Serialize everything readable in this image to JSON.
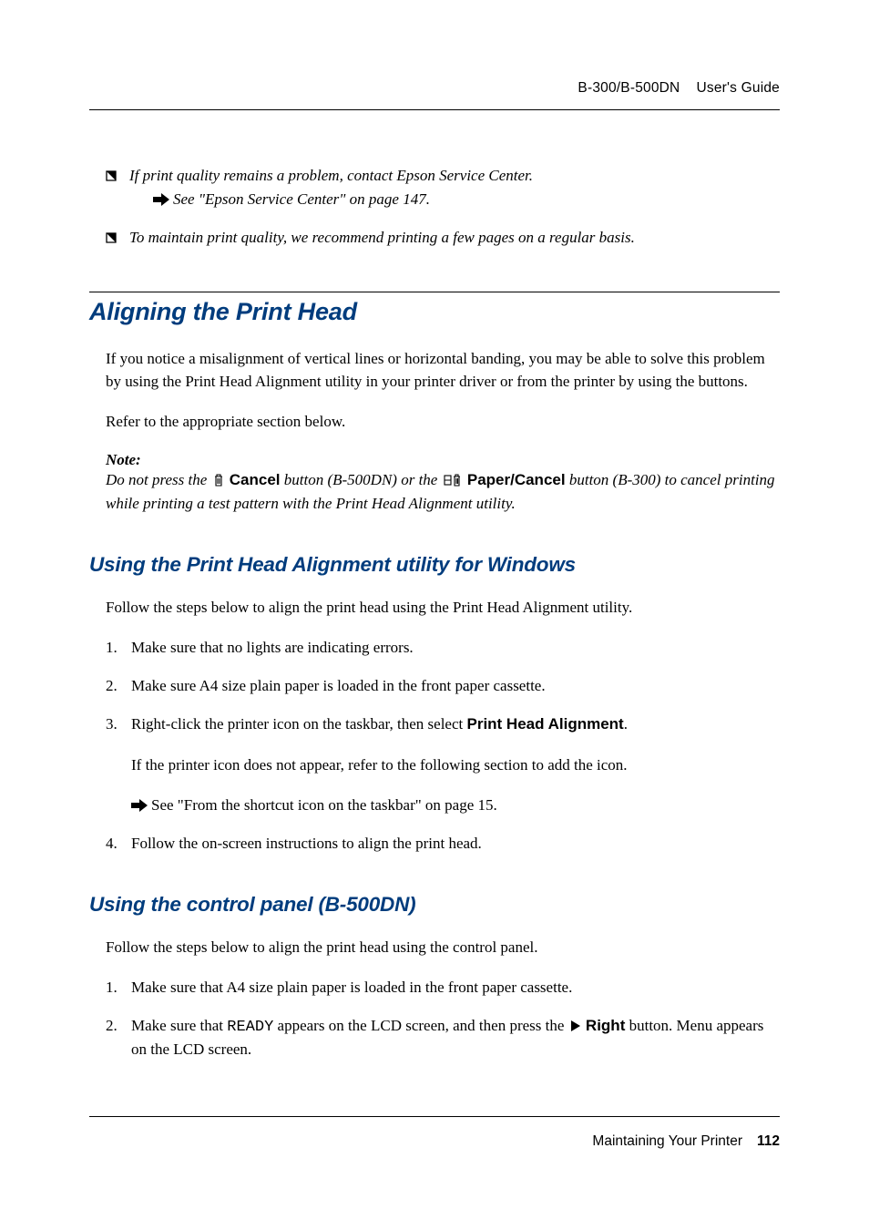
{
  "header": {
    "model": "B-300/B-500DN",
    "doc_title": "User's Guide"
  },
  "bullets": {
    "b1": "If print quality remains a problem, contact Epson Service Center.",
    "b1_ref": "See \"Epson Service Center\" on page 147.",
    "b2": "To maintain print quality, we recommend printing a few pages on a regular basis."
  },
  "section_align": {
    "title": "Aligning the Print Head",
    "p1": "If you notice a misalignment of vertical lines or horizontal banding, you may be able to solve this problem by using the Print Head Alignment utility in your printer driver or from the printer by using the buttons.",
    "p2": "Refer to the appropriate section below.",
    "note_label": "Note:",
    "note_pre": "Do not press the ",
    "note_cancel": "Cancel",
    "note_mid1": " button (B-500DN) or the ",
    "note_paper_cancel": "Paper/Cancel",
    "note_mid2": " button (B-300) to cancel printing while printing a test pattern with the Print Head Alignment utility."
  },
  "section_win": {
    "title": "Using the Print Head Alignment utility for Windows",
    "intro": "Follow the steps below to align the print head using the Print Head Alignment utility.",
    "s1": "Make sure that no lights are indicating errors.",
    "s2": "Make sure A4 size plain paper is loaded in the front paper cassette.",
    "s3_pre": "Right-click the printer icon on the taskbar, then select ",
    "s3_bold": "Print Head Alignment",
    "s3_post": ".",
    "s3_sub": "If the printer icon does not appear, refer to the following section to add the icon.",
    "s3_ref": "See \"From the shortcut icon on the taskbar\" on page 15.",
    "s4": "Follow the on-screen instructions to align the print head."
  },
  "section_cp": {
    "title": "Using the control panel (B-500DN)",
    "intro": "Follow the steps below to align the print head using the control panel.",
    "s1": "Make sure that A4 size plain paper is loaded in the front paper cassette.",
    "s2_pre": "Make sure that ",
    "s2_lcd": "READY",
    "s2_mid": " appears on the LCD screen, and then press the ",
    "s2_btn": "Right",
    "s2_post": " button. Menu appears on the LCD screen."
  },
  "footer": {
    "chapter": "Maintaining Your Printer",
    "page": "112"
  }
}
